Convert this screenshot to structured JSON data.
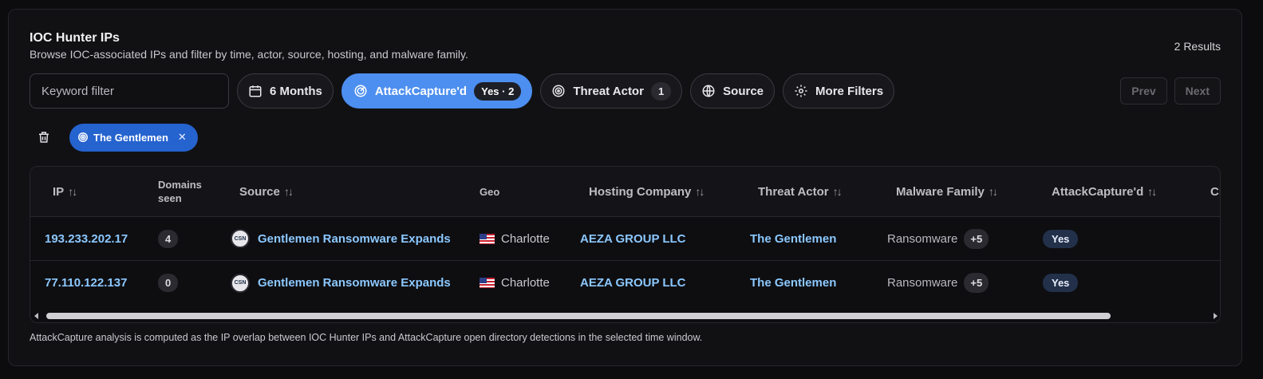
{
  "header": {
    "title": "IOC Hunter IPs",
    "subtitle": "Browse IOC-associated IPs and filter by time, actor, source, hosting, and malware family.",
    "results": "2 Results"
  },
  "toolbar": {
    "keyword_placeholder": "Keyword filter",
    "time_label": "6 Months",
    "attackcapture_label": "AttackCapture'd",
    "attackcapture_badge": "Yes · 2",
    "threat_actor_label": "Threat Actor",
    "threat_actor_badge": "1",
    "source_label": "Source",
    "more_filters_label": "More Filters"
  },
  "pager": {
    "prev": "Prev",
    "next": "Next"
  },
  "active_chip": {
    "label": "The Gentlemen",
    "remove": "✕"
  },
  "table": {
    "headers": {
      "ip": "IP",
      "domains": "Domains seen",
      "source": "Source",
      "geo": "Geo",
      "hosting": "Hosting Company",
      "actor": "Threat Actor",
      "malware": "Malware Family",
      "attackcapture": "AttackCapture'd",
      "cut": "Cr"
    },
    "sort_glyph": "↑↓",
    "rows": [
      {
        "ip": "193.233.202.17",
        "domains": "4",
        "source_logo": "CSN",
        "source": "Gentlemen Ransomware Expands (",
        "geo": "Charlotte",
        "hosting": "AEZA GROUP LLC",
        "actor": "The Gentlemen",
        "malware": "Ransomware",
        "malware_more": "+5",
        "attackcapture": "Yes"
      },
      {
        "ip": "77.110.122.137",
        "domains": "0",
        "source_logo": "CSN",
        "source": "Gentlemen Ransomware Expands (",
        "geo": "Charlotte",
        "hosting": "AEZA GROUP LLC",
        "actor": "The Gentlemen",
        "malware": "Ransomware",
        "malware_more": "+5",
        "attackcapture": "Yes"
      }
    ]
  },
  "footnote": "AttackCapture analysis is computed as the IP overlap between IOC Hunter IPs and AttackCapture open directory detections in the selected time window."
}
